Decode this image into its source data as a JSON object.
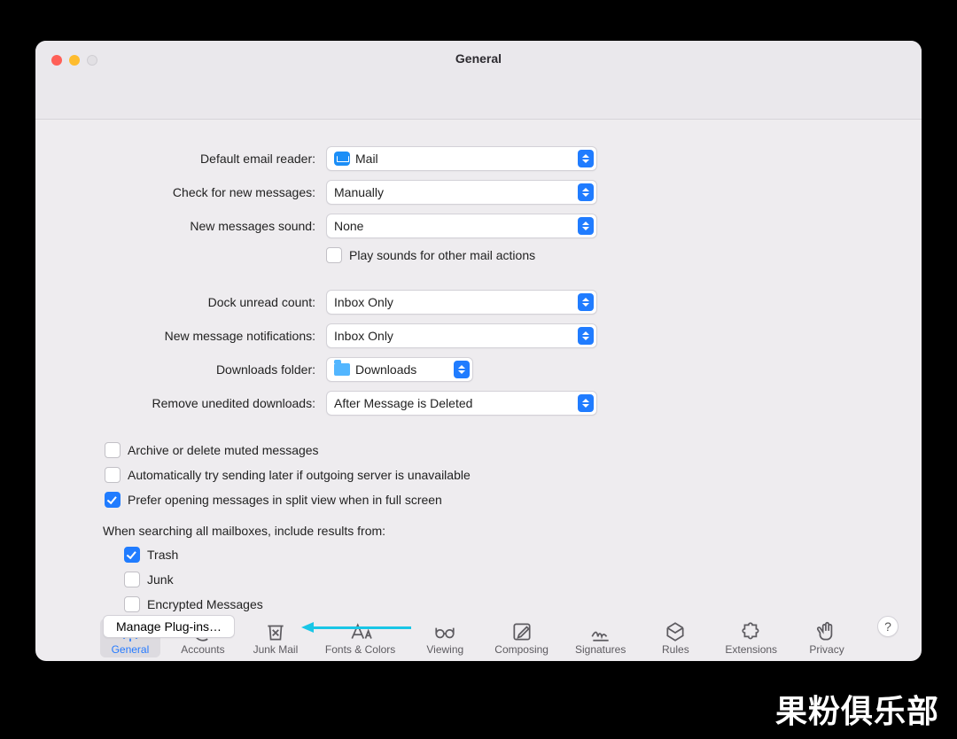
{
  "window": {
    "title": "General"
  },
  "tabs": [
    {
      "id": "general",
      "label": "General",
      "active": true
    },
    {
      "id": "accounts",
      "label": "Accounts",
      "active": false
    },
    {
      "id": "junk",
      "label": "Junk Mail",
      "active": false
    },
    {
      "id": "fonts",
      "label": "Fonts & Colors",
      "active": false
    },
    {
      "id": "viewing",
      "label": "Viewing",
      "active": false
    },
    {
      "id": "composing",
      "label": "Composing",
      "active": false
    },
    {
      "id": "signatures",
      "label": "Signatures",
      "active": false
    },
    {
      "id": "rules",
      "label": "Rules",
      "active": false
    },
    {
      "id": "extensions",
      "label": "Extensions",
      "active": false
    },
    {
      "id": "privacy",
      "label": "Privacy",
      "active": false
    }
  ],
  "form": {
    "default_reader": {
      "label": "Default email reader:",
      "value": "Mail",
      "icon": "app"
    },
    "check_messages": {
      "label": "Check for new messages:",
      "value": "Manually"
    },
    "new_sound": {
      "label": "New messages sound:",
      "value": "None"
    },
    "play_sounds": {
      "label": "Play sounds for other mail actions",
      "checked": false
    },
    "dock_count": {
      "label": "Dock unread count:",
      "value": "Inbox Only"
    },
    "notifications": {
      "label": "New message notifications:",
      "value": "Inbox Only"
    },
    "downloads_folder": {
      "label": "Downloads folder:",
      "value": "Downloads",
      "icon": "folder"
    },
    "remove_downloads": {
      "label": "Remove unedited downloads:",
      "value": "After Message is Deleted"
    }
  },
  "options": {
    "archive_muted": {
      "label": "Archive or delete muted messages",
      "checked": false
    },
    "retry_send": {
      "label": "Automatically try sending later if outgoing server is unavailable",
      "checked": false
    },
    "split_view": {
      "label": "Prefer opening messages in split view when in full screen",
      "checked": true
    }
  },
  "search": {
    "heading": "When searching all mailboxes, include results from:",
    "trash": {
      "label": "Trash",
      "checked": true
    },
    "junk": {
      "label": "Junk",
      "checked": false
    },
    "encrypted": {
      "label": "Encrypted Messages",
      "checked": false
    }
  },
  "footer": {
    "manage_plugins": "Manage Plug-ins…",
    "help": "?"
  },
  "watermark": "果粉俱乐部"
}
